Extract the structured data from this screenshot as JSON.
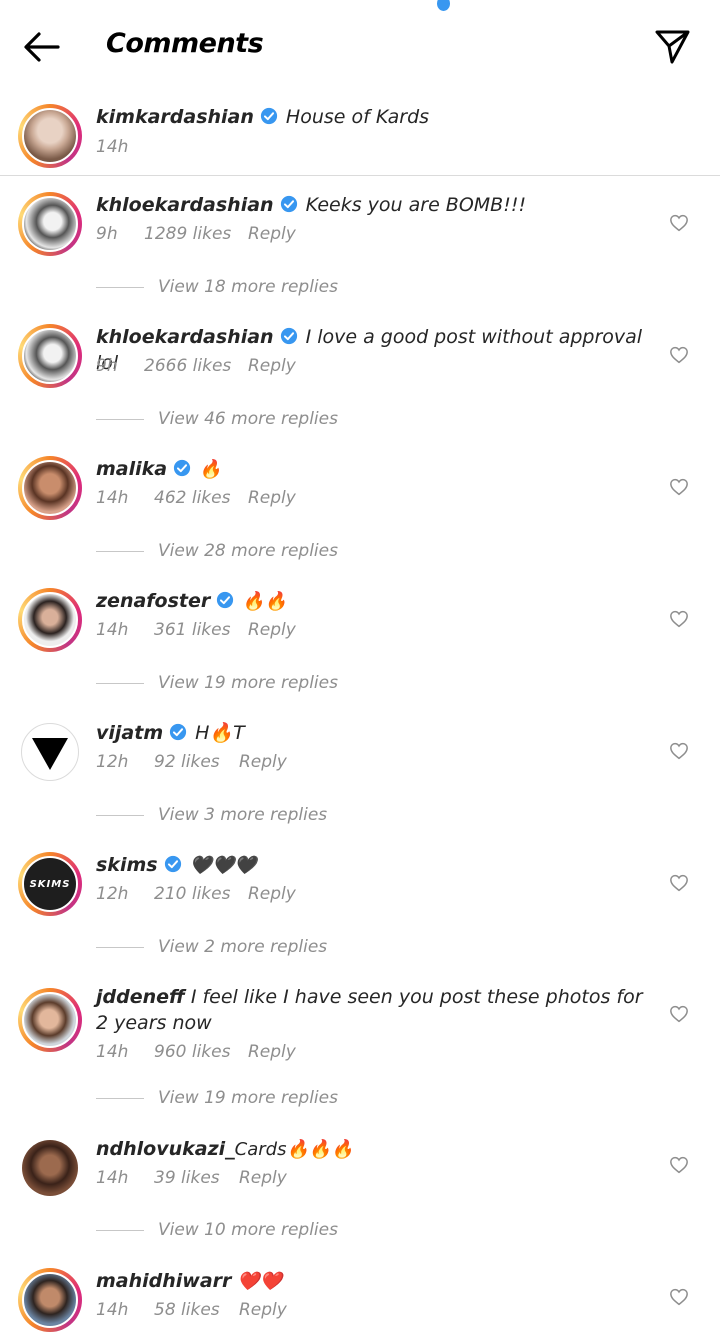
{
  "header": {
    "title": "Comments",
    "back_icon": "arrow-left-icon",
    "send_icon": "paper-plane-icon"
  },
  "caption": {
    "username": "kimkardashian",
    "verified": true,
    "text": "House of Kards",
    "time": "14h"
  },
  "comments": [
    {
      "username": "khloekardashian",
      "verified": true,
      "text": "Keeks you are BOMB!!!",
      "time": "9h",
      "likes": "1289 likes",
      "reply": "Reply",
      "view_replies": "View 18 more replies"
    },
    {
      "username": "khloekardashian",
      "verified": true,
      "text": "I love a good post without approval lol",
      "time": "9h",
      "likes": "2666 likes",
      "reply": "Reply",
      "view_replies": "View 46 more replies"
    },
    {
      "username": "malika",
      "verified": true,
      "text": "🔥",
      "time": "14h",
      "likes": "462 likes",
      "reply": "Reply",
      "view_replies": "View 28 more replies"
    },
    {
      "username": "zenafoster",
      "verified": true,
      "text": "🔥🔥",
      "time": "14h",
      "likes": "361 likes",
      "reply": "Reply",
      "view_replies": "View 19 more replies"
    },
    {
      "username": "vijatm",
      "verified": true,
      "text": "H🔥T",
      "time": "12h",
      "likes": "92 likes",
      "reply": "Reply",
      "view_replies": "View 3 more replies"
    },
    {
      "username": "skims",
      "verified": true,
      "text": "🖤🖤🖤",
      "avatar_text": "SKIMS",
      "time": "12h",
      "likes": "210 likes",
      "reply": "Reply",
      "view_replies": "View 2 more replies"
    },
    {
      "username": "jddeneff",
      "verified": false,
      "text": "I feel like I have seen you post these photos for 2 years now",
      "time": "14h",
      "likes": "960 likes",
      "reply": "Reply",
      "view_replies": "View 19 more replies"
    },
    {
      "username": "ndhlovukazi_",
      "verified": false,
      "text": "Cards🔥🔥🔥",
      "time": "14h",
      "likes": "39 likes",
      "reply": "Reply",
      "view_replies": "View 10 more replies"
    },
    {
      "username": "mahidhiwarr",
      "verified": false,
      "text": "❤️❤️",
      "time": "14h",
      "likes": "58 likes",
      "reply": "Reply"
    }
  ],
  "colors": {
    "verified": "#3897f0",
    "meta": "#8e8e8e",
    "text": "#262626"
  }
}
